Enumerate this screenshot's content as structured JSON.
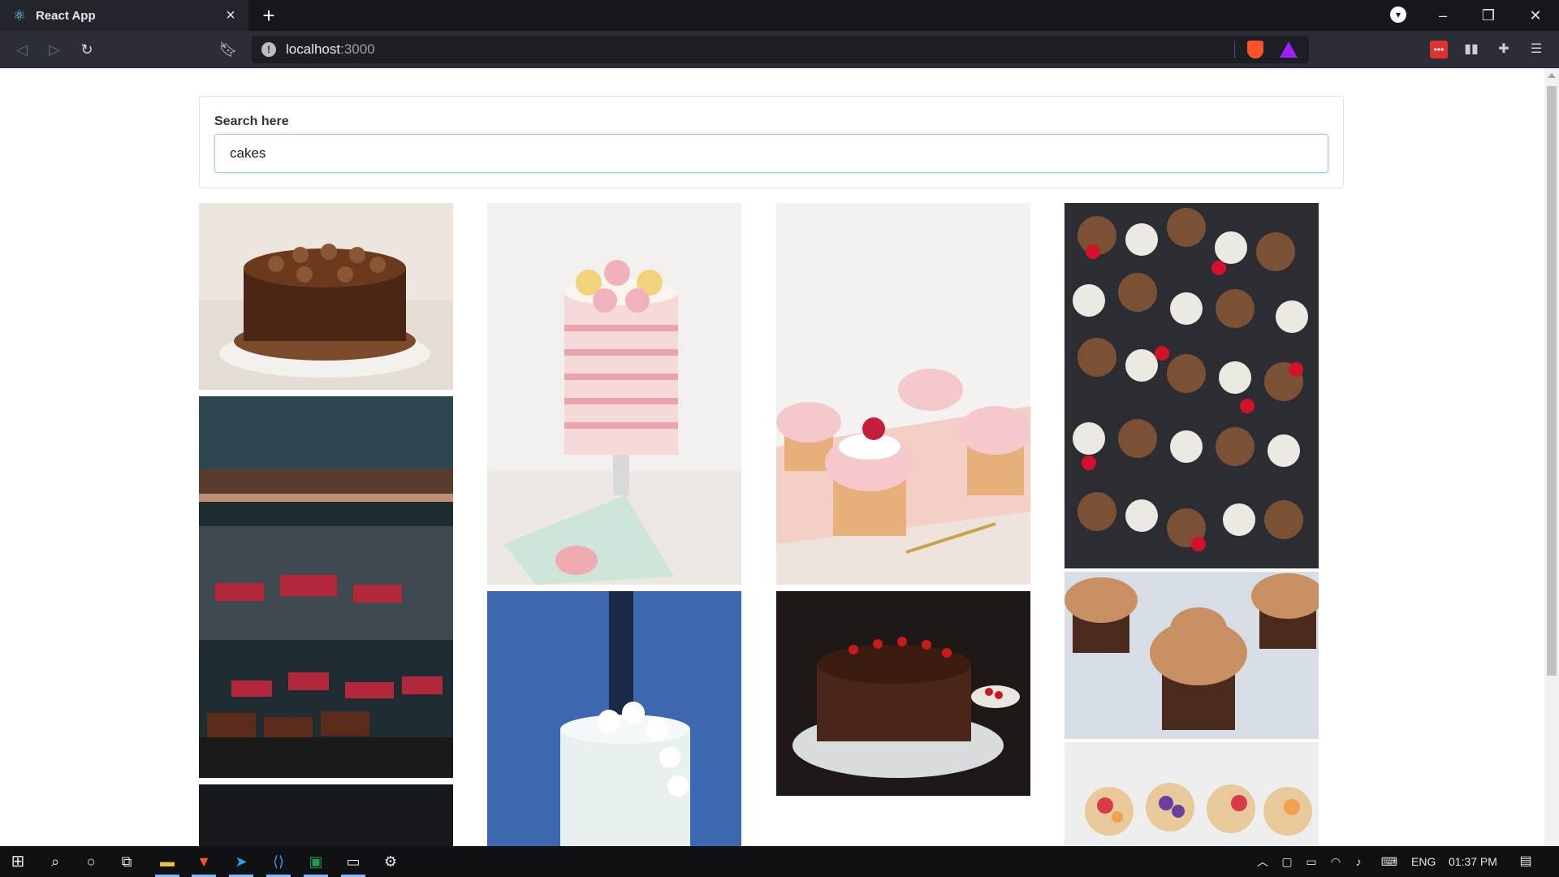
{
  "browser": {
    "tab": {
      "title": "React App",
      "favicon": "react-icon"
    },
    "url": {
      "host": "localhost",
      "port": ":3000"
    }
  },
  "page": {
    "search": {
      "label": "Search here",
      "value": "cakes"
    },
    "images": [
      {
        "name": "chocolate-frosted-cake"
      },
      {
        "name": "bakery-display-case"
      },
      {
        "name": "dark-placeholder-photo"
      },
      {
        "name": "pink-macaron-drip-cake"
      },
      {
        "name": "white-rose-wedding-cake"
      },
      {
        "name": "strawberry-cupcakes"
      },
      {
        "name": "chocolate-cherry-cake"
      },
      {
        "name": "assorted-mini-cupcakes"
      },
      {
        "name": "chocolate-swirl-cupcakes"
      },
      {
        "name": "fruit-tarts"
      }
    ]
  },
  "taskbar": {
    "language": "ENG",
    "time": "01:37 PM"
  },
  "colors": {
    "chrome_dark": "#15171c",
    "toolbar": "#2b2e36",
    "input_focus": "#a8c7e8",
    "brave_orange": "#fb542b"
  }
}
